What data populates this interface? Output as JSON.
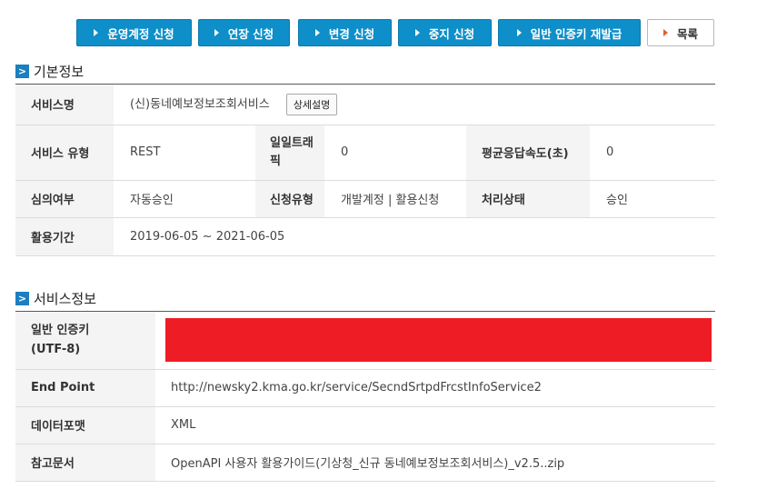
{
  "toolbar": {
    "btn_ops": "운영계정 신청",
    "btn_extend": "연장 신청",
    "btn_change": "변경 신청",
    "btn_stop": "중지 신청",
    "btn_reissue": "일반 인증키 재발급",
    "btn_list": "목록"
  },
  "basic": {
    "title": "기본정보",
    "service_name_label": "서비스명",
    "service_name_value": "(신)동네예보정보조회서비스",
    "detail_button": "상세설명",
    "service_type_label": "서비스 유형",
    "service_type_value": "REST",
    "daily_traffic_label": "일일트래픽",
    "daily_traffic_value": "0",
    "avg_response_label": "평균응답속도(초)",
    "avg_response_value": "0",
    "review_label": "심의여부",
    "review_value": "자동승인",
    "apply_type_label": "신청유형",
    "apply_type_value": "개발계정 | 활용신청",
    "status_label": "처리상태",
    "status_value": "승인",
    "period_label": "활용기간",
    "period_value": "2019-06-05 ~ 2021-06-05"
  },
  "service": {
    "title": "서비스정보",
    "auth_key_label": "일반 인증키\n(UTF-8)",
    "endpoint_label": "End Point",
    "endpoint_value": "http://newsky2.kma.go.kr/service/SecndSrtpdFrcstInfoService2",
    "format_label": "데이터포맷",
    "format_value": "XML",
    "ref_doc_label": "참고문서",
    "ref_doc_value": "OpenAPI 사용자 활용가이드(기상청_신규 동네예보정보조회서비스)_v2.5..zip"
  },
  "colors": {
    "primary_button": "#0e8fc9",
    "redaction": "#ee1c25",
    "section_icon": "#1c7fbf"
  }
}
